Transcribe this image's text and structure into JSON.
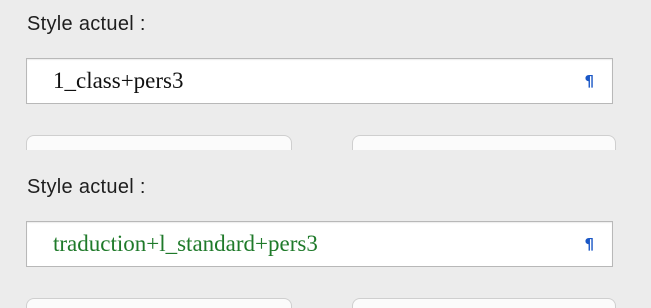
{
  "panels": [
    {
      "label": "Style actuel :",
      "style_value": "1_class+pers3",
      "style_value_color": "#111111",
      "paragraph_mark": "¶"
    },
    {
      "label": "Style actuel :",
      "style_value": "traduction+l_standard+pers3",
      "style_value_color": "#1f7a2a",
      "paragraph_mark": "¶"
    }
  ],
  "colors": {
    "background": "#ececec",
    "paragraph_mark": "#1a57c6"
  }
}
